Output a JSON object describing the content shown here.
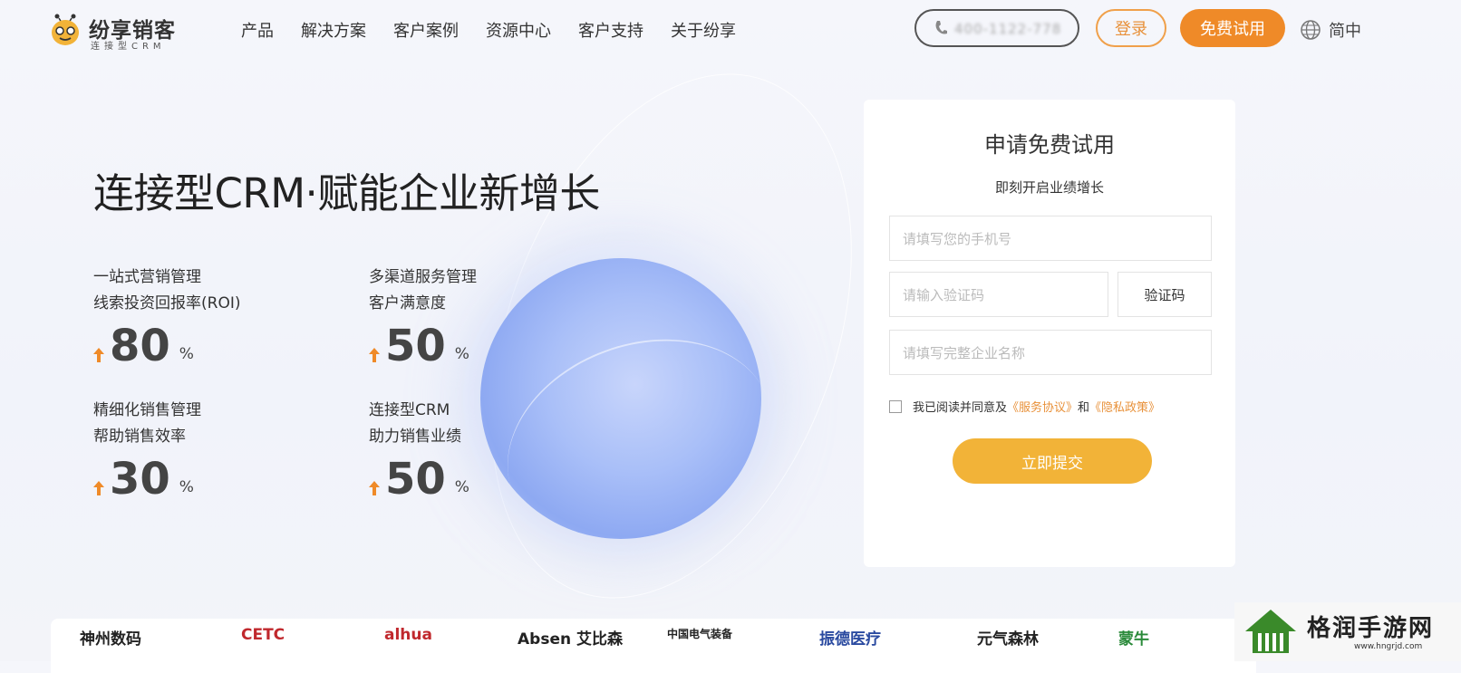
{
  "header": {
    "logo": {
      "name": "纷享销客",
      "sub": "连接型CRM"
    },
    "nav": [
      "产品",
      "解决方案",
      "客户案例",
      "资源中心",
      "客户支持",
      "关于纷享"
    ],
    "phone": "400-1122-778",
    "login": "登录",
    "trial": "免费试用",
    "lang": "简中"
  },
  "hero": {
    "title": "连接型CRM·赋能企业新增长",
    "stats": [
      {
        "line1": "一站式营销管理",
        "line2": "线索投资回报率(ROI)",
        "value": "80",
        "unit": "%"
      },
      {
        "line1": "多渠道服务管理",
        "line2": "客户满意度",
        "value": "50",
        "unit": "%"
      },
      {
        "line1": "精细化销售管理",
        "line2": "帮助销售效率",
        "value": "30",
        "unit": "%"
      },
      {
        "line1": "连接型CRM",
        "line2": "助力销售业绩",
        "value": "50",
        "unit": "%"
      }
    ]
  },
  "form": {
    "title": "申请免费试用",
    "subtitle": "即刻开启业绩增长",
    "phone_placeholder": "请填写您的手机号",
    "code_placeholder": "请输入验证码",
    "code_button": "验证码",
    "company_placeholder": "请填写完整企业名称",
    "agree_prefix": "我已阅读并同意及",
    "terms": "《服务协议》",
    "and": "和",
    "privacy": "《隐私政策》",
    "submit": "立即提交"
  },
  "partners": [
    "神州数码",
    "CETC",
    "alhua",
    "Absen 艾比森",
    "中国电气装备",
    "振德医疗",
    "元气森林",
    "蒙牛"
  ],
  "watermark": {
    "text": "格润手游网",
    "url": "www.hngrjd.com"
  },
  "colors": {
    "accent": "#ef8a28",
    "submit": "#f2b338",
    "link": "#e8913a"
  }
}
